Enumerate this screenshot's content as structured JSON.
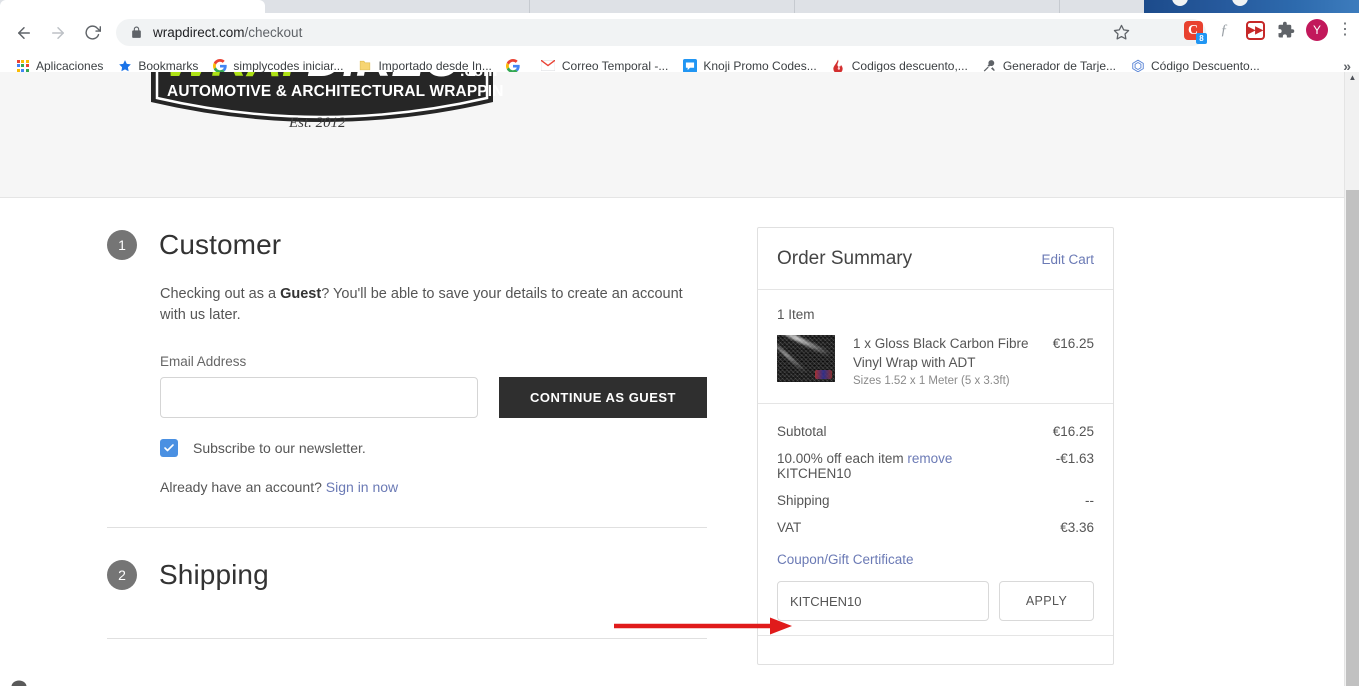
{
  "browser": {
    "url_domain": "wrapdirect.com",
    "url_path": "/checkout",
    "back_icon": "back-arrow-icon",
    "forward_icon": "forward-arrow-icon",
    "reload_icon": "reload-icon",
    "lock_icon": "lock-icon",
    "star_icon": "bookmark-star-icon",
    "menu_icon": "kebab-menu-icon",
    "profile_initial": "Y",
    "extensions": [
      {
        "name": "coupon-extension",
        "label": "C",
        "badge": "8"
      },
      {
        "name": "honey-extension",
        "label": "h",
        "badge": ""
      },
      {
        "name": "rakuten-extension",
        "label": "M",
        "badge": ""
      },
      {
        "name": "extensions-puzzle",
        "label": "",
        "badge": ""
      }
    ],
    "bookmarks": [
      {
        "label": "Aplicaciones",
        "icon": "apps-grid-icon"
      },
      {
        "label": "Bookmarks",
        "icon": "star-icon"
      },
      {
        "label": "simplycodes iniciar...",
        "icon": "google-g-icon"
      },
      {
        "label": "Importado desde In...",
        "icon": "folder-icon"
      },
      {
        "label": "",
        "icon": "google-g-icon"
      },
      {
        "label": "Correo Temporal -...",
        "icon": "gmail-icon"
      },
      {
        "label": "Knoji Promo Codes...",
        "icon": "knoji-chat-icon"
      },
      {
        "label": "Codigos descuento,...",
        "icon": "flame-icon"
      },
      {
        "label": "Generador de Tarje...",
        "icon": "tools-icon"
      },
      {
        "label": "Código Descuento...",
        "icon": "tag-icon"
      }
    ],
    "overflow_label": "»"
  },
  "site": {
    "logo_top": "WRAP",
    "logo_top2": "DIRECT",
    "logo_dotcom": ".com",
    "logo_sub": "AUTOMOTIVE & ARCHITECTURAL WRAPPING SUPPLIES",
    "logo_est": "Est. 2012",
    "logo_accent_color": "#aee215",
    "logo_bg_color": "#262626"
  },
  "customer": {
    "step_number": "1",
    "title": "Customer",
    "guest_text_1": "Checking out as a ",
    "guest_text_bold": "Guest",
    "guest_text_2": "? You'll be able to save your details to create an account with us later.",
    "email_label": "Email Address",
    "email_value": "",
    "email_placeholder": "",
    "continue_button": "CONTINUE AS GUEST",
    "newsletter_label": "Subscribe to our newsletter.",
    "newsletter_checked": true,
    "account_prompt": "Already have an account? ",
    "signin_link": "Sign in now"
  },
  "shipping": {
    "step_number": "2",
    "title": "Shipping"
  },
  "order_summary": {
    "title": "Order Summary",
    "edit_cart": "Edit Cart",
    "item_count": "1 Item",
    "items": [
      {
        "name": "1 x Gloss Black Carbon Fibre Vinyl Wrap with ADT",
        "sub": "Sizes 1.52 x 1 Meter (5 x 3.3ft)",
        "price": "€16.25",
        "thumb": "carbon-fibre-vinyl-thumbnail"
      }
    ],
    "totals": [
      {
        "label": "Subtotal",
        "value": "€16.25",
        "type": "plain"
      },
      {
        "label": "10.00% off each item ",
        "link": "remove",
        "code": "KITCHEN10",
        "value": "-€1.63",
        "type": "discount"
      },
      {
        "label": "Shipping",
        "value": "--",
        "type": "plain"
      },
      {
        "label": "VAT",
        "value": "€3.36",
        "type": "plain"
      }
    ],
    "coupon_link": "Coupon/Gift Certificate",
    "coupon_value": "KITCHEN10",
    "coupon_placeholder": "Coupon/Gift Certificate",
    "apply_button": "APPLY"
  },
  "annotation": {
    "arrow_color": "#e01b1b",
    "arrow_name": "red-pointer-arrow"
  },
  "colors": {
    "accent_link": "#6b7ab5",
    "button_dark": "#2f2f2f",
    "checkbox_blue": "#4a90e2",
    "step_circle": "#757575"
  }
}
